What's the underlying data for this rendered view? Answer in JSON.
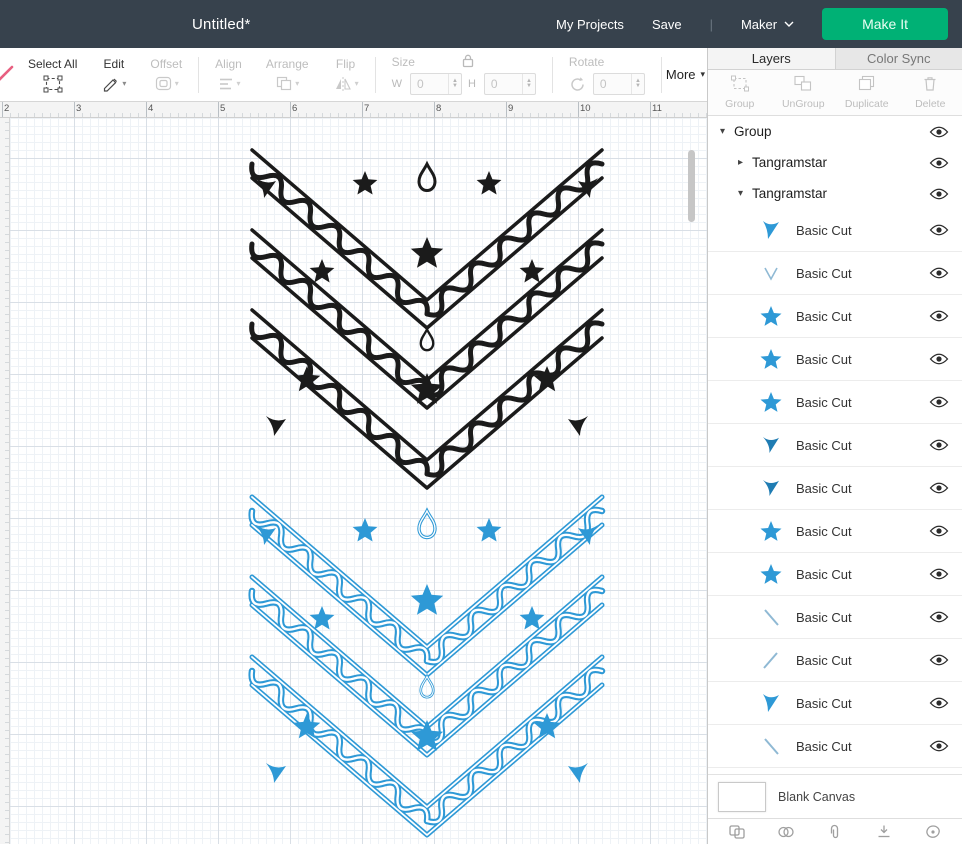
{
  "colors": {
    "header_bg": "#37424d",
    "make_it_green": "#00b175",
    "black_pattern": "#1b1b1b",
    "blue_pattern": "#2e99d6",
    "blue_dark": "#1f7cb3",
    "blue_light": "#8fb9d4"
  },
  "header": {
    "title": "Untitled*",
    "my_projects": "My Projects",
    "save": "Save",
    "divider": "|",
    "machine": "Maker",
    "make_it": "Make It"
  },
  "toolbar": {
    "select_all": "Select All",
    "edit": "Edit",
    "offset": "Offset",
    "align": "Align",
    "arrange": "Arrange",
    "flip": "Flip",
    "size_label": "Size",
    "w_label": "W",
    "w_value": "0",
    "h_label": "H",
    "h_value": "0",
    "rotate_label": "Rotate",
    "rotate_value": "0",
    "more_label": "More"
  },
  "rulers": {
    "top": [
      "2",
      "3",
      "4",
      "5",
      "6",
      "7",
      "8",
      "9",
      "10",
      "11"
    ]
  },
  "canvas": {
    "objects": [
      {
        "name": "chevron-star-pattern",
        "color_key": "black_pattern",
        "style": "solid"
      },
      {
        "name": "chevron-star-pattern",
        "color_key": "blue_pattern",
        "style": "outline"
      }
    ]
  },
  "panel": {
    "tabs": [
      {
        "label": "Layers",
        "active": true
      },
      {
        "label": "Color Sync",
        "active": false
      }
    ],
    "actions": [
      {
        "label": "Group"
      },
      {
        "label": "UnGroup"
      },
      {
        "label": "Duplicate"
      },
      {
        "label": "Delete"
      }
    ],
    "tree": [
      {
        "label": "Group",
        "caret": "down",
        "indent": 0
      },
      {
        "label": "Tangramstar",
        "caret": "right",
        "indent": 1
      },
      {
        "label": "Tangramstar",
        "caret": "down",
        "indent": 1
      }
    ],
    "items": [
      {
        "label": "Basic Cut",
        "shape": "flag"
      },
      {
        "label": "Basic Cut",
        "shape": "vee"
      },
      {
        "label": "Basic Cut",
        "shape": "star"
      },
      {
        "label": "Basic Cut",
        "shape": "star"
      },
      {
        "label": "Basic Cut",
        "shape": "star"
      },
      {
        "label": "Basic Cut",
        "shape": "bird"
      },
      {
        "label": "Basic Cut",
        "shape": "bird"
      },
      {
        "label": "Basic Cut",
        "shape": "star"
      },
      {
        "label": "Basic Cut",
        "shape": "star"
      },
      {
        "label": "Basic Cut",
        "shape": "diag-left"
      },
      {
        "label": "Basic Cut",
        "shape": "diag-right"
      },
      {
        "label": "Basic Cut",
        "shape": "flag"
      },
      {
        "label": "Basic Cut",
        "shape": "diag-left"
      }
    ],
    "blank_canvas_label": "Blank Canvas",
    "tools": [
      "slice",
      "weld",
      "attach",
      "flatten",
      "contour"
    ]
  }
}
